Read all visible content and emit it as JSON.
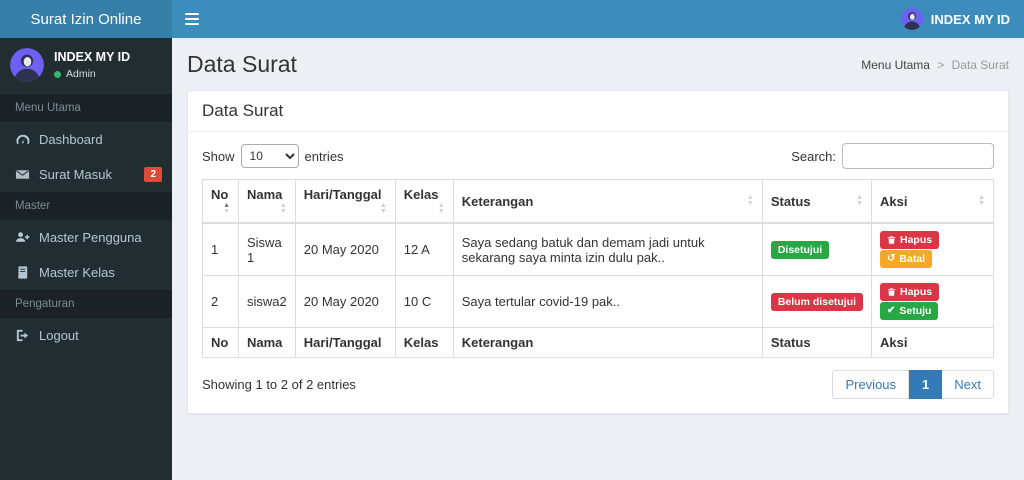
{
  "navbar": {
    "brand": "Surat Izin Online",
    "user_name": "INDEX MY ID"
  },
  "sidebar": {
    "user": {
      "name": "INDEX MY ID",
      "role": "Admin"
    },
    "sections": [
      {
        "header": "Menu Utama",
        "items": [
          {
            "label": "Dashboard",
            "icon": "dashboard-icon"
          },
          {
            "label": "Surat Masuk",
            "icon": "envelope-icon",
            "badge": "2"
          }
        ]
      },
      {
        "header": "Master",
        "items": [
          {
            "label": "Master Pengguna",
            "icon": "user-plus-icon"
          },
          {
            "label": "Master Kelas",
            "icon": "book-icon"
          }
        ]
      },
      {
        "header": "Pengaturan",
        "items": [
          {
            "label": "Logout",
            "icon": "logout-icon"
          }
        ]
      }
    ]
  },
  "page": {
    "title": "Data Surat",
    "breadcrumb": {
      "parent": "Menu Utama",
      "separator": ">",
      "current": "Data Surat"
    }
  },
  "card": {
    "title": "Data Surat",
    "length_menu": {
      "prefix": "Show",
      "selected": "10",
      "suffix": "entries"
    },
    "search": {
      "label": "Search:",
      "value": ""
    },
    "table": {
      "headers": [
        "No",
        "Nama",
        "Hari/Tanggal",
        "Kelas",
        "Keterangan",
        "Status",
        "Aksi"
      ],
      "rows": [
        {
          "no": "1",
          "nama": "Siswa 1",
          "tanggal": "20 May 2020",
          "kelas": "12 A",
          "keterangan": "Saya sedang batuk dan demam jadi untuk sekarang saya minta izin dulu pak..",
          "status": {
            "label": "Disetujui",
            "type": "success"
          },
          "actions": [
            {
              "label": "Hapus",
              "icon": "trash-icon",
              "type": "danger"
            },
            {
              "label": "Batal",
              "icon": "undo-icon",
              "type": "warning"
            }
          ]
        },
        {
          "no": "2",
          "nama": "siswa2",
          "tanggal": "20 May 2020",
          "kelas": "10 C",
          "keterangan": "Saya tertular covid-19 pak..",
          "status": {
            "label": "Belum disetujui",
            "type": "danger"
          },
          "actions": [
            {
              "label": "Hapus",
              "icon": "trash-icon",
              "type": "danger"
            },
            {
              "label": "Setuju",
              "icon": "check-icon",
              "type": "success"
            }
          ]
        }
      ]
    },
    "info": "Showing 1 to 2 of 2 entries",
    "pagination": {
      "previous": "Previous",
      "page": "1",
      "next": "Next"
    }
  },
  "colors": {
    "navbar": "#3c8dbc",
    "logo": "#367fa9",
    "sidebar": "#222d32",
    "menu_header_bg": "#1a2226",
    "menu_text": "#b8c7ce",
    "success": "#28a745",
    "danger": "#dc3545",
    "warning": "#f9a825",
    "sidebar_badge": "#dd4b39",
    "pagination_active": "#337ab7",
    "avatar_bg": "#6e5ff5",
    "content_bg": "#ecf0f5"
  }
}
